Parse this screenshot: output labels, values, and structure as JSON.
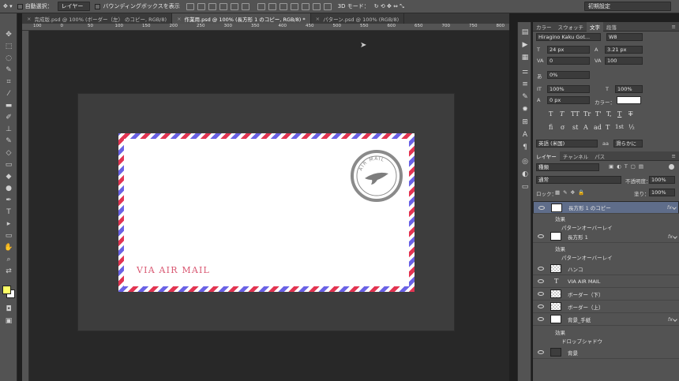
{
  "options_bar": {
    "auto_select_label": "自動選択：",
    "auto_select_value": "レイヤー",
    "bounding_box_label": "バウンディングボックスを表示",
    "mode_3d_label": "3D モード：",
    "workspace_value": "初期設定"
  },
  "tabs": [
    {
      "label": "完成版.psd @ 100% (ボーダー（左） のコピー, RGB/8)",
      "active": false
    },
    {
      "label": "作業用.psd @ 100% (長方形 1 のコピー, RGB/8) *",
      "active": true
    },
    {
      "label": "パターン.psd @ 100% (RGB/8)",
      "active": false
    }
  ],
  "ruler_numbers": [
    "100",
    "0",
    "50",
    "100",
    "150",
    "200",
    "250",
    "300",
    "350",
    "400",
    "450",
    "500",
    "550",
    "600",
    "650",
    "700",
    "750",
    "800"
  ],
  "envelope": {
    "airmail_text": "VIA AIR MAIL"
  },
  "stamp": {
    "text": "AIR MAIL"
  },
  "colors": {
    "red_stripe": "#e23552",
    "blue_stripe": "#6a62e5",
    "airmail_text": "#d95872",
    "canvas": "#3d3d3d",
    "selected_layer": "#5f6d8a"
  },
  "char_panel": {
    "tabs": [
      "カラー",
      "スウォッチ",
      "文字",
      "段落"
    ],
    "active_tab": "文字",
    "font_family": "Hiragino Kaku Got...",
    "font_style": "W8",
    "font_size": "24 px",
    "leading": "3.21 px",
    "kerning": "0",
    "tracking": "100",
    "tsume": "0%",
    "vertical_scale": "100%",
    "horizontal_scale": "100%",
    "baseline_shift": "0 px",
    "color_label": "カラー：",
    "color_value": "#ffffff",
    "type_toggles": [
      "T",
      "T",
      "TT",
      "Tr",
      "T'",
      "T,",
      "T",
      "T"
    ],
    "opentype_toggles": [
      "fi",
      "σ",
      "st",
      "A",
      "ad",
      "T",
      "1st",
      "½"
    ],
    "language": "英語 (米国)",
    "antialias": "滑らかに"
  },
  "layers_panel": {
    "tabs": [
      "レイヤー",
      "チャンネル",
      "パス"
    ],
    "active_tab": "レイヤー",
    "filter_kind": "種類",
    "blend_mode": "通常",
    "opacity_label": "不透明度：",
    "opacity_value": "100%",
    "lock_label": "ロック：",
    "fill_label": "塗り：",
    "fill_value": "100%",
    "layers": [
      {
        "name": "長方形 1 のコピー",
        "thumb": "white",
        "fx": true,
        "selected": true,
        "effects_label": "効果",
        "effects": [
          "パターンオーバーレイ"
        ]
      },
      {
        "name": "長方形 1",
        "thumb": "white",
        "fx": true,
        "selected": false,
        "effects_label": "効果",
        "effects": [
          "パターンオーバーレイ"
        ]
      },
      {
        "name": "ハンコ",
        "thumb": "check",
        "fx": false,
        "selected": false
      },
      {
        "name": "VIA AIR MAIL",
        "thumb": "type",
        "fx": false,
        "selected": false
      },
      {
        "name": "ボーダー（下）",
        "thumb": "check",
        "fx": false,
        "selected": false
      },
      {
        "name": "ボーダー（上）",
        "thumb": "check",
        "fx": false,
        "selected": false
      },
      {
        "name": "背景_手紙",
        "thumb": "white",
        "fx": true,
        "selected": false,
        "effects_label": "効果",
        "effects": [
          "ドロップシャドウ"
        ]
      },
      {
        "name": "背景",
        "thumb": "dark",
        "fx": false,
        "selected": false
      }
    ]
  }
}
